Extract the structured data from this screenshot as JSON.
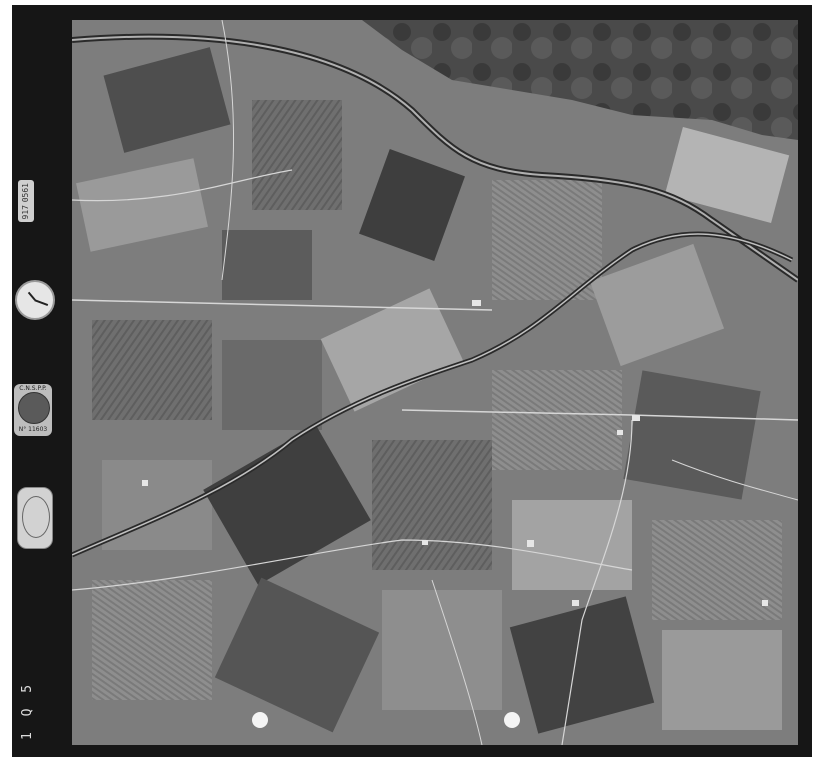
{
  "photo": {
    "type": "aerial-photograph",
    "subject": "agricultural fields, canals and roads",
    "colors": {
      "film_frame": "#161616",
      "field_mid": "#7d7d7d",
      "field_dark": "#3e3e3e",
      "field_light": "#b4b4b4",
      "road": "#d6d6d6"
    }
  },
  "margin": {
    "frame_number": "1 Q 5",
    "film_code_lines": [
      "0561",
      "917"
    ],
    "altimeter_top": "C.N.S.P.P.",
    "altimeter_bottom": "N° 11603",
    "icons": {
      "clock": "clock-icon",
      "altimeter": "altimeter-icon",
      "level": "bubble-level-icon"
    }
  }
}
